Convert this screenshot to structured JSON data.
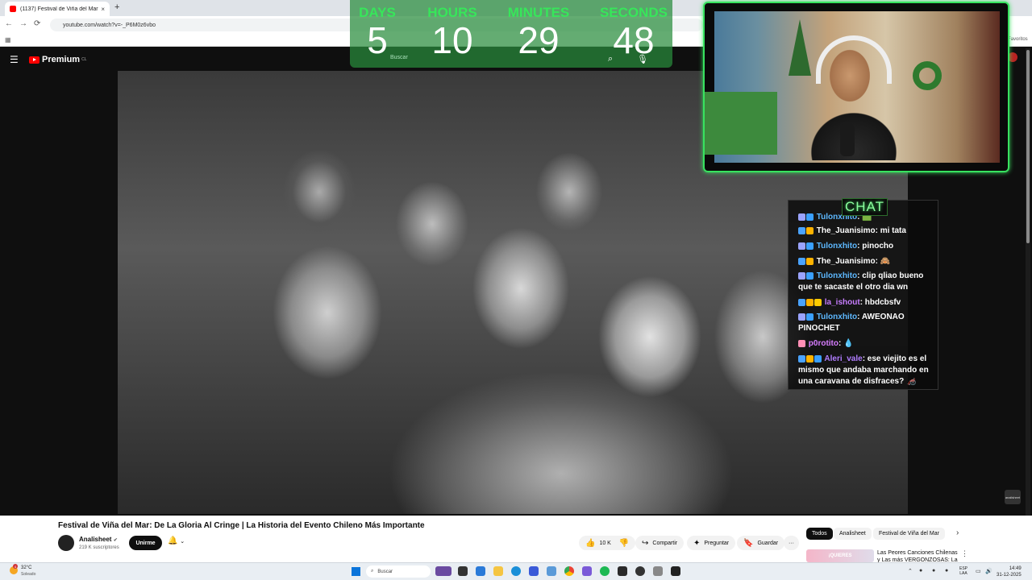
{
  "browser": {
    "tab_title": "(1137) Festival de Viña del Mar",
    "tab_close": "×",
    "new_tab": "+",
    "url": "youtube.com/watch?v=-_P6M0z6vbo",
    "bookmarks_right": "Favoritos"
  },
  "youtube": {
    "logo_text": "Premium",
    "logo_region": "CL"
  },
  "countdown": {
    "units": [
      {
        "label": "DAYS",
        "value": "5"
      },
      {
        "label": "HOURS",
        "value": "10"
      },
      {
        "label": "MINUTES",
        "value": "29"
      },
      {
        "label": "SECONDS",
        "value": "48"
      }
    ],
    "search_placeholder": "Buscar"
  },
  "chat": {
    "title": "CHAT",
    "messages": [
      {
        "user": "Tulonxhito",
        "user_color": "#5db8ff",
        "text": "🟩",
        "badges": [
          "#9aa3ff",
          "#3aa0ff"
        ]
      },
      {
        "user": "The_Juanisimo",
        "user_color": "#ffffff",
        "text": "mi tata",
        "badges": [
          "#4aa3ff",
          "#ffb300"
        ]
      },
      {
        "user": "Tulonxhito",
        "user_color": "#5db8ff",
        "text": "pinocho",
        "badges": [
          "#9aa3ff",
          "#3aa0ff"
        ]
      },
      {
        "user": "The_Juanisimo",
        "user_color": "#ffffff",
        "text": "🙈",
        "badges": [
          "#4aa3ff",
          "#ffb300"
        ]
      },
      {
        "user": "Tulonxhito",
        "user_color": "#5db8ff",
        "text": "clip qliao bueno que te sacaste el otro dia wn",
        "badges": [
          "#9aa3ff",
          "#3aa0ff"
        ]
      },
      {
        "user": "la_ishout",
        "user_color": "#c77dff",
        "text": "hbdcbsfv",
        "badges": [
          "#4aa3ff",
          "#ffb300",
          "#ffcc00"
        ]
      },
      {
        "user": "Tulonxhito",
        "user_color": "#5db8ff",
        "text": "AWEONAO PINOCHET",
        "badges": [
          "#9aa3ff",
          "#3aa0ff"
        ]
      },
      {
        "user": "p0rotito",
        "user_color": "#d77dff",
        "text": "💧",
        "badges": [
          "#ff8fb5"
        ]
      },
      {
        "user": "Aleri_vale",
        "user_color": "#b07dff",
        "text": "ese viejito es el mismo que andaba marchando en una caravana de disfraces? 🦽",
        "badges": [
          "#4aa3ff",
          "#ffb300",
          "#3aa0ff"
        ]
      }
    ]
  },
  "video": {
    "title": "Festival de Viña del Mar: De La Gloria Al Cringe | La Historia del Evento Chileno Más Importante",
    "channel": "Analisheet",
    "verified": "✔",
    "subscribers": "219 K suscriptores",
    "join_label": "Unirme",
    "likes": "10 K",
    "share_label": "Compartir",
    "ask_label": "Preguntar",
    "save_label": "Guardar",
    "more_label": "···",
    "watermark": "analisheet"
  },
  "sidebar_chips": [
    "Todos",
    "Analisheet",
    "Festival de Viña del Mar"
  ],
  "recommendation": {
    "thumb_text": "¡QUIERES",
    "title": "Las Peores Canciones Chilenas y Las más VERGONZOSAS: La"
  },
  "taskbar": {
    "temp": "32°C",
    "condition": "Soleado",
    "weather_badge": "4",
    "search_placeholder": "Buscar",
    "lang_top": "ESP",
    "lang_bottom": "LAA",
    "time": "14:49",
    "date": "31-12-2025"
  }
}
